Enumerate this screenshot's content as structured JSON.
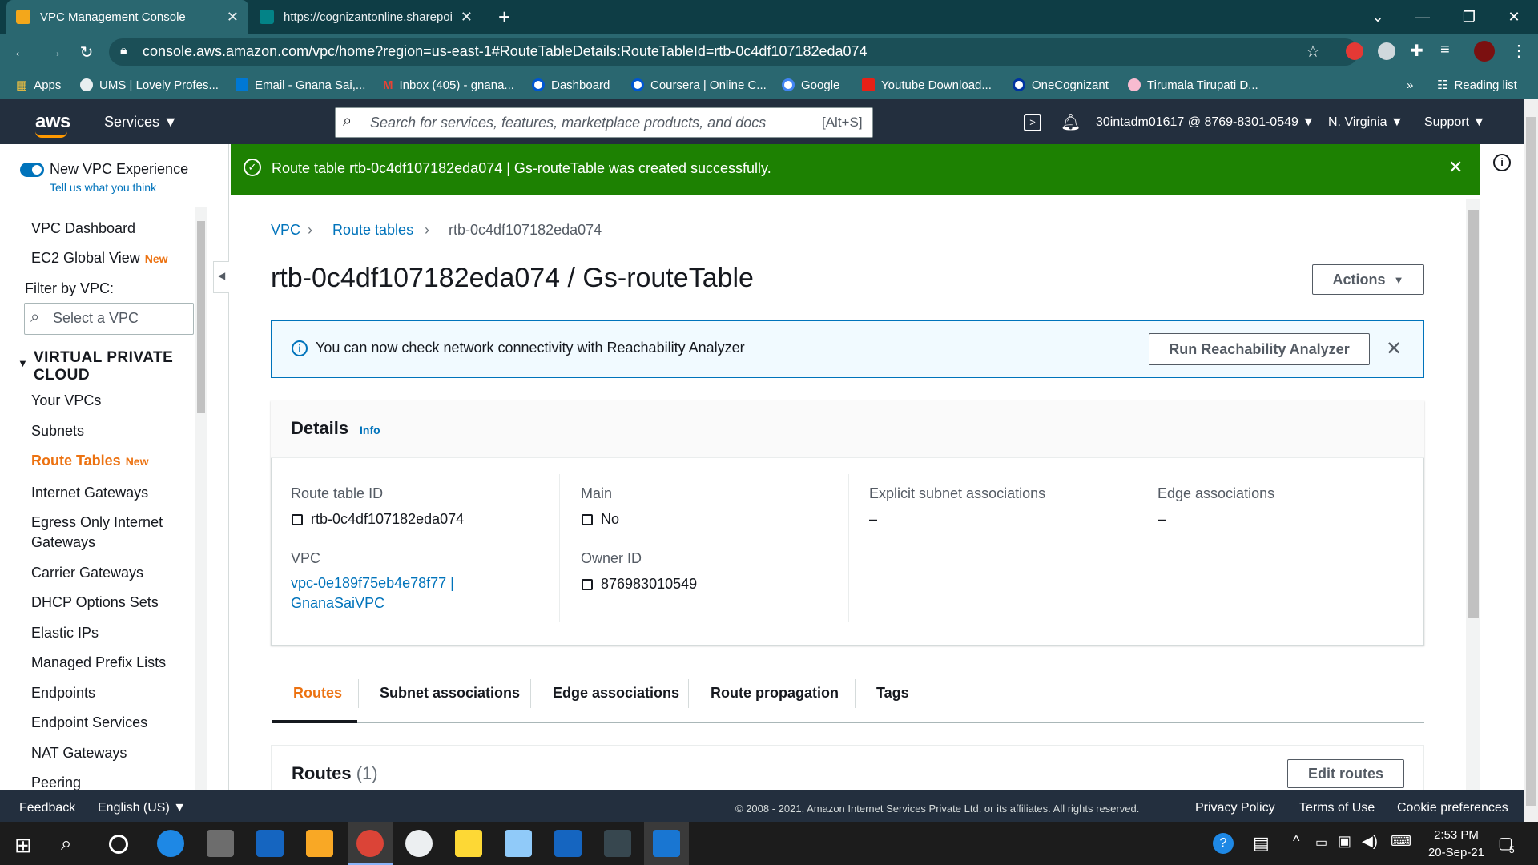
{
  "browser": {
    "tabs": [
      {
        "title": "VPC Management Console"
      },
      {
        "title": "https://cognizantonline.sharepoi"
      }
    ],
    "url": "console.aws.amazon.com/vpc/home?region=us-east-1#RouteTableDetails:RouteTableId=rtb-0c4df107182eda074",
    "bookmarks": [
      "Apps",
      "UMS | Lovely Profes...",
      "Email - Gnana Sai,...",
      "Inbox (405) - gnana...",
      "Dashboard",
      "Coursera | Online C...",
      "Google",
      "Youtube Download...",
      "OneCognizant",
      "Tirumala Tirupati D..."
    ],
    "bookmarks_more": "»",
    "reading_list": "Reading list"
  },
  "aws_nav": {
    "logo": "aws",
    "services": "Services",
    "search_placeholder": "Search for services, features, marketplace products, and docs",
    "search_shortcut": "[Alt+S]",
    "account": "30intadm01617 @ 8769-8301-0549",
    "region": "N. Virginia",
    "support": "Support"
  },
  "sidebar": {
    "experience_label": "New VPC Experience",
    "feedback_link": "Tell us what you think",
    "vpc_dashboard": "VPC Dashboard",
    "ec2_global_view": "EC2 Global View",
    "new_tag": "New",
    "filter_label": "Filter by VPC:",
    "filter_placeholder": "Select a VPC",
    "section_line1": "VIRTUAL PRIVATE",
    "section_line2": "CLOUD",
    "items": [
      "Your VPCs",
      "Subnets",
      "Route Tables",
      "Internet Gateways",
      "Egress Only Internet",
      "Gateways",
      "Carrier Gateways",
      "DHCP Options Sets",
      "Elastic IPs",
      "Managed Prefix Lists",
      "Endpoints",
      "Endpoint Services",
      "NAT Gateways",
      "Peering"
    ]
  },
  "flash": {
    "message": "Route table rtb-0c4df107182eda074 | Gs-routeTable was created successfully."
  },
  "breadcrumb": [
    "VPC",
    "Route tables",
    "rtb-0c4df107182eda074"
  ],
  "page": {
    "title": "rtb-0c4df107182eda074 / Gs-routeTable",
    "actions": "Actions"
  },
  "info_banner": {
    "text": "You can now check network connectivity with Reachability Analyzer",
    "button": "Run Reachability Analyzer"
  },
  "details": {
    "heading": "Details",
    "info": "Info",
    "route_table_id_label": "Route table ID",
    "route_table_id": "rtb-0c4df107182eda074",
    "main_label": "Main",
    "main": "No",
    "explicit_label": "Explicit subnet associations",
    "explicit": "–",
    "edge_label": "Edge associations",
    "edge": "–",
    "vpc_label": "VPC",
    "vpc_line1": "vpc-0e189f75eb4e78f77 |",
    "vpc_line2": "GnanaSaiVPC",
    "owner_label": "Owner ID",
    "owner": "876983010549"
  },
  "tabs": [
    "Routes",
    "Subnet associations",
    "Edge associations",
    "Route propagation",
    "Tags"
  ],
  "routes": {
    "heading": "Routes",
    "count": "(1)",
    "edit_button": "Edit routes"
  },
  "footer": {
    "feedback": "Feedback",
    "language": "English (US)",
    "copyright": "© 2008 - 2021, Amazon Internet Services Private Ltd. or its affiliates. All rights reserved.",
    "privacy": "Privacy Policy",
    "terms": "Terms of Use",
    "cookies": "Cookie preferences"
  },
  "taskbar": {
    "time": "2:53 PM",
    "date": "20-Sep-21",
    "notifications": "5"
  },
  "colors": {
    "aws_nav": "#232f3e",
    "aws_orange": "#ec7211",
    "success_green": "#1d8102",
    "link_blue": "#0073bb",
    "chrome_teal": "#2a6770"
  }
}
